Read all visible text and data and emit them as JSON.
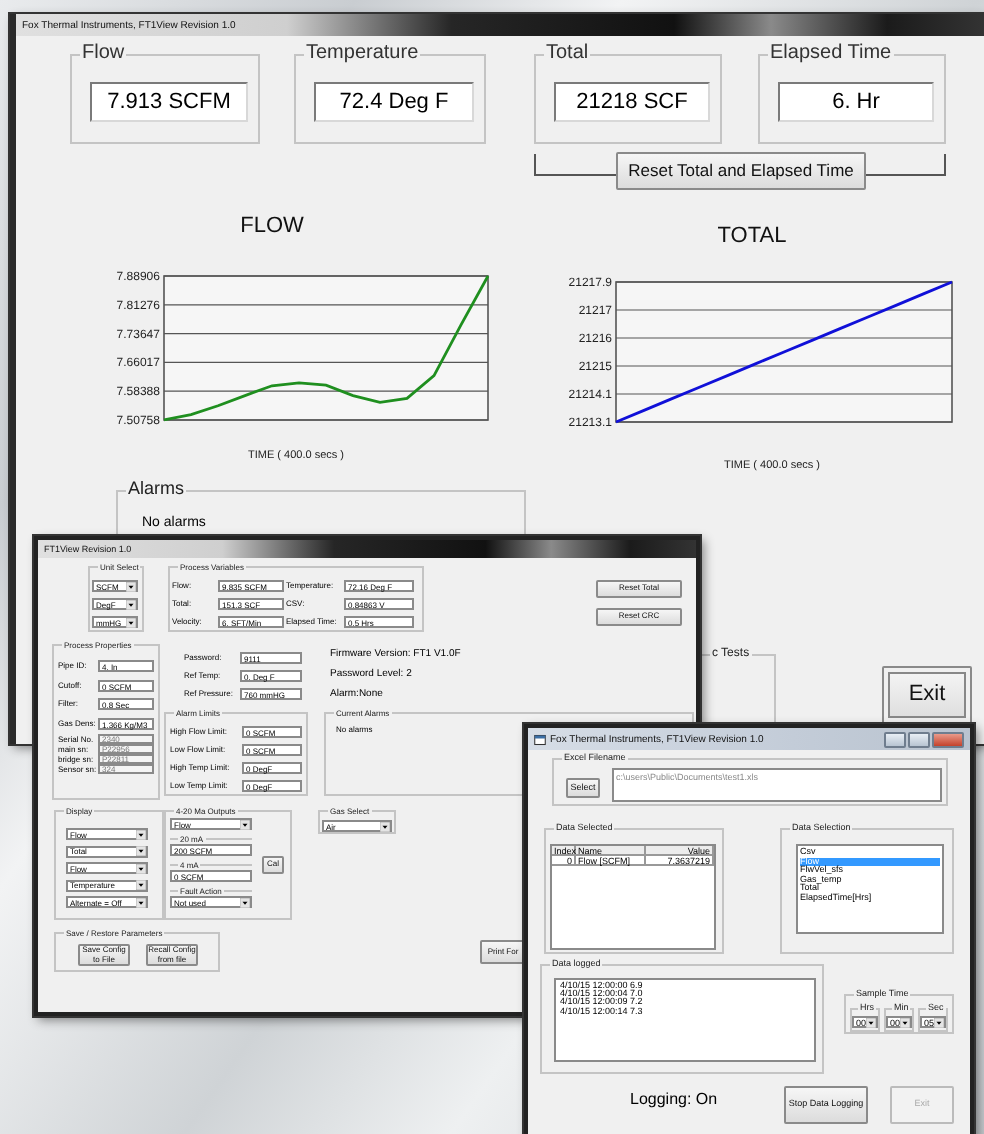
{
  "main_window": {
    "title": "Fox Thermal Instruments,  FT1View Revision 1.0",
    "readouts": [
      {
        "label": "Flow",
        "value": "7.913 SCFM"
      },
      {
        "label": "Temperature",
        "value": "72.4 Deg F"
      },
      {
        "label": "Total",
        "value": "21218 SCF"
      },
      {
        "label": "Elapsed Time",
        "value": "6.  Hr"
      }
    ],
    "reset_button": "Reset Total and Elapsed Time",
    "charts": [
      {
        "chart_data": {
          "type": "line",
          "title": "FLOW",
          "xlabel": "TIME ( 400.0 secs )",
          "ylim": [
            7.50758,
            7.88906
          ],
          "yticks": [
            7.50758,
            7.58388,
            7.66017,
            7.73647,
            7.81276,
            7.88906
          ],
          "grid": true,
          "series": [
            {
              "color": "#1f8f1f",
              "values": [
                7.508,
                7.522,
                7.545,
                7.572,
                7.598,
                7.606,
                7.6,
                7.572,
                7.554,
                7.565,
                7.625,
                7.76,
                7.889
              ]
            }
          ]
        }
      },
      {
        "chart_data": {
          "type": "line",
          "title": "TOTAL",
          "xlabel": "TIME ( 400.0 secs )",
          "ylim": [
            21213.1,
            21217.9
          ],
          "yticks": [
            {
              "value": 21213.1,
              "label": "21213.1"
            },
            {
              "value": 21214.06,
              "label": "21214.1"
            },
            {
              "value": 21215.02,
              "label": "21215"
            },
            {
              "value": 21215.98,
              "label": "21216"
            },
            {
              "value": 21216.94,
              "label": "21217"
            },
            {
              "value": 21217.9,
              "label": "21217.9"
            }
          ],
          "grid": true,
          "series": [
            {
              "color": "#1010d8",
              "values": [
                21213.1,
                21213.5,
                21213.9,
                21214.3,
                21214.7,
                21215.1,
                21215.5,
                21215.9,
                21216.3,
                21216.7,
                21217.1,
                21217.5,
                21217.9
              ]
            }
          ]
        }
      }
    ],
    "alarms": {
      "label": "Alarms",
      "text": "No alarms"
    },
    "tests_label": "c Tests",
    "exit_button": "Exit"
  },
  "config_window": {
    "title": "FT1View Revision 1.0",
    "unit_select": {
      "label": "Unit Select",
      "dropdowns": [
        "SCFM",
        "DegF",
        "mmHG"
      ]
    },
    "process_variables": {
      "label": "Process Variables",
      "fields": [
        {
          "label": "Flow:",
          "value": "9.835 SCFM"
        },
        {
          "label": "Temperature:",
          "value": "72.16 Deg F"
        },
        {
          "label": "Total:",
          "value": "151.3 SCF"
        },
        {
          "label": "CSV:",
          "value": "0.84863 V"
        },
        {
          "label": "Velocity:",
          "value": "6. SFT/Min"
        },
        {
          "label": "Elapsed Time:",
          "value": "0.5 Hrs"
        }
      ]
    },
    "buttons": [
      "Reset Total",
      "Reset CRC"
    ],
    "process_properties": {
      "label": "Process Properties",
      "fields": [
        {
          "label": "Pipe ID:",
          "value": "4. In",
          "disabled": false
        },
        {
          "label": "Cutoff:",
          "value": "0 SCFM",
          "disabled": false
        },
        {
          "label": "Filter:",
          "value": "0.8 Sec",
          "disabled": false
        },
        {
          "label": "Gas Dens:",
          "value": "1.366 Kg/M3",
          "disabled": false
        },
        {
          "label": "Serial No.",
          "value": "2340",
          "disabled": true
        },
        {
          "label": "main sn:",
          "value": "P22956",
          "disabled": true
        },
        {
          "label": "bridge sn:",
          "value": "P22811",
          "disabled": true
        },
        {
          "label": "Sensor sn:",
          "value": "324",
          "disabled": true
        }
      ]
    },
    "settings": [
      {
        "label": "Password:",
        "value": "9111"
      },
      {
        "label": "Ref Temp:",
        "value": "0. Deg F"
      },
      {
        "label": "Ref Pressure:",
        "value": "760 mmHG"
      }
    ],
    "status_lines": [
      "Firmware Version: FT1 V1.0F",
      "Password Level: 2",
      "Alarm:None"
    ],
    "alarm_limits": {
      "label": "Alarm Limits",
      "fields": [
        {
          "label": "High Flow Limit:",
          "value": "0 SCFM"
        },
        {
          "label": "Low Flow Limit:",
          "value": "0 SCFM"
        },
        {
          "label": "High Temp Limit:",
          "value": "0 DegF"
        },
        {
          "label": "Low Temp Limit:",
          "value": "0 DegF"
        }
      ]
    },
    "current_alarms": {
      "label": "Current Alarms",
      "text": "No alarms"
    },
    "display": {
      "label": "Display",
      "dropdowns": [
        "Flow",
        "Total",
        "Flow",
        "Temperature",
        "Alternate = Off"
      ]
    },
    "outputs": {
      "label": "4-20 Ma Outputs",
      "dropdown": "Flow",
      "high": {
        "label": "20 mA",
        "value": "200 SCFM"
      },
      "low": {
        "label": "4 mA",
        "value": "0 SCFM"
      },
      "fault": {
        "label": "Fault Action",
        "value": "Not used"
      },
      "cal_button": "Cal"
    },
    "gas_select": {
      "label": "Gas Select",
      "value": "Air"
    },
    "save_restore": {
      "label": "Save / Restore Parameters",
      "buttons": [
        "Save Config to File",
        "Recall Config from file"
      ]
    },
    "print_button": "Print For"
  },
  "logging_window": {
    "title": "Fox Thermal Instruments,  FT1View Revision 1.0",
    "excel": {
      "label": "Excel Filename",
      "button": "Select",
      "path": "c:\\users\\Public\\Documents\\test1.xls"
    },
    "data_selected": {
      "label": "Data Selected",
      "columns": [
        "Index",
        "Name",
        "Value"
      ],
      "rows": [
        [
          "0",
          "Flow [SCFM]",
          "7.3637219"
        ]
      ]
    },
    "data_selection": {
      "label": "Data Selection",
      "items": [
        {
          "text": "Csv",
          "selected": false
        },
        {
          "text": "Flow",
          "selected": true
        },
        {
          "text": "FlwVel_sfs",
          "selected": false
        },
        {
          "text": "Gas_temp",
          "selected": false
        },
        {
          "text": "Total",
          "selected": false
        },
        {
          "text": "ElapsedTime[Hrs]",
          "selected": false
        }
      ]
    },
    "data_logged": {
      "label": "Data logged",
      "lines": [
        "4/10/15 12:00:00  6.9",
        "4/10/15 12:00:04  7.0",
        "4/10/15 12:00:09  7.2",
        "4/10/15 12:00:14  7.3"
      ]
    },
    "sample_time": {
      "label": "Sample Time",
      "units": [
        {
          "label": "Hrs",
          "value": "00"
        },
        {
          "label": "Min",
          "value": "00"
        },
        {
          "label": "Sec",
          "value": "05"
        }
      ]
    },
    "status": "Logging: On",
    "buttons": [
      {
        "label": "Stop Data Logging",
        "disabled": false
      },
      {
        "label": "Exit",
        "disabled": true
      }
    ]
  }
}
